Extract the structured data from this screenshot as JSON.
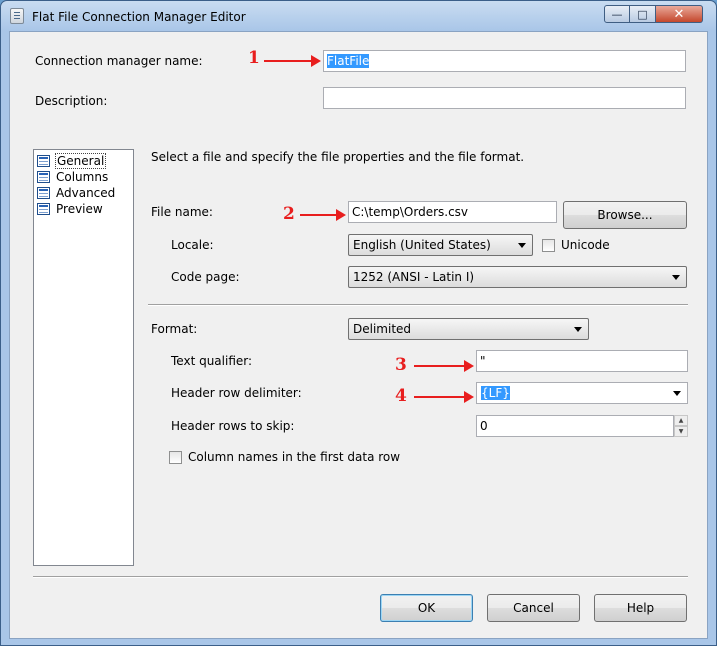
{
  "window": {
    "title": "Flat File Connection Manager Editor",
    "minimize_glyph": "—",
    "maximize_glyph": "□",
    "close_glyph": "✕"
  },
  "connection": {
    "name_label": "Connection manager name:",
    "name_value": "FlatFile",
    "description_label": "Description:",
    "description_value": ""
  },
  "nav": {
    "items": [
      {
        "label": "General",
        "selected": true
      },
      {
        "label": "Columns",
        "selected": false
      },
      {
        "label": "Advanced",
        "selected": false
      },
      {
        "label": "Preview",
        "selected": false
      }
    ]
  },
  "general": {
    "intro": "Select a file and specify the file properties and the file format.",
    "file_name_label": "File name:",
    "file_name_value": "C:\\temp\\Orders.csv",
    "browse_label": "Browse...",
    "locale_label": "Locale:",
    "locale_value": "English (United States)",
    "unicode_label": "Unicode",
    "unicode_checked": false,
    "code_page_label": "Code page:",
    "code_page_value": "1252  (ANSI - Latin I)",
    "format_label": "Format:",
    "format_value": "Delimited",
    "text_qualifier_label": "Text qualifier:",
    "text_qualifier_value": "\"",
    "header_row_delimiter_label": "Header row delimiter:",
    "header_row_delimiter_value": "{LF}",
    "header_rows_skip_label": "Header rows to skip:",
    "header_rows_skip_value": "0",
    "column_names_label": "Column names in the first data row",
    "column_names_checked": false
  },
  "annotations": [
    "1",
    "2",
    "3",
    "4"
  ],
  "buttons": {
    "ok": "OK",
    "cancel": "Cancel",
    "help": "Help"
  },
  "colors": {
    "selection": "#3399ff",
    "annotation": "#e81e1e",
    "dialog_bg": "#f0f0f0"
  }
}
